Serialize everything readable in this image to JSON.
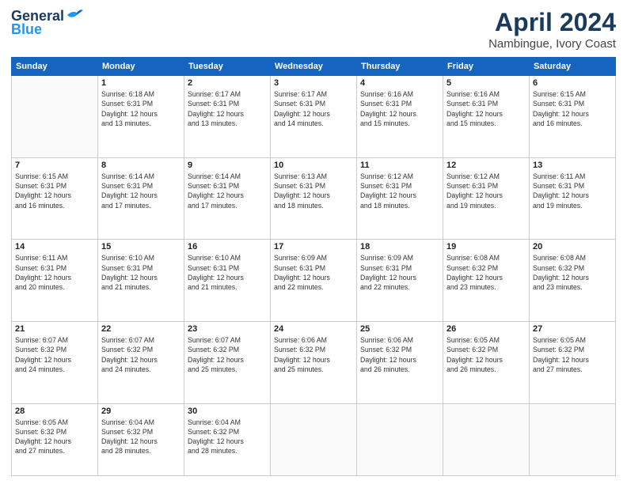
{
  "logo": {
    "line1": "General",
    "line2": "Blue"
  },
  "title": "April 2024",
  "subtitle": "Nambingue, Ivory Coast",
  "days_of_week": [
    "Sunday",
    "Monday",
    "Tuesday",
    "Wednesday",
    "Thursday",
    "Friday",
    "Saturday"
  ],
  "weeks": [
    [
      {
        "num": "",
        "info": ""
      },
      {
        "num": "1",
        "info": "Sunrise: 6:18 AM\nSunset: 6:31 PM\nDaylight: 12 hours\nand 13 minutes."
      },
      {
        "num": "2",
        "info": "Sunrise: 6:17 AM\nSunset: 6:31 PM\nDaylight: 12 hours\nand 13 minutes."
      },
      {
        "num": "3",
        "info": "Sunrise: 6:17 AM\nSunset: 6:31 PM\nDaylight: 12 hours\nand 14 minutes."
      },
      {
        "num": "4",
        "info": "Sunrise: 6:16 AM\nSunset: 6:31 PM\nDaylight: 12 hours\nand 15 minutes."
      },
      {
        "num": "5",
        "info": "Sunrise: 6:16 AM\nSunset: 6:31 PM\nDaylight: 12 hours\nand 15 minutes."
      },
      {
        "num": "6",
        "info": "Sunrise: 6:15 AM\nSunset: 6:31 PM\nDaylight: 12 hours\nand 16 minutes."
      }
    ],
    [
      {
        "num": "7",
        "info": "Sunrise: 6:15 AM\nSunset: 6:31 PM\nDaylight: 12 hours\nand 16 minutes."
      },
      {
        "num": "8",
        "info": "Sunrise: 6:14 AM\nSunset: 6:31 PM\nDaylight: 12 hours\nand 17 minutes."
      },
      {
        "num": "9",
        "info": "Sunrise: 6:14 AM\nSunset: 6:31 PM\nDaylight: 12 hours\nand 17 minutes."
      },
      {
        "num": "10",
        "info": "Sunrise: 6:13 AM\nSunset: 6:31 PM\nDaylight: 12 hours\nand 18 minutes."
      },
      {
        "num": "11",
        "info": "Sunrise: 6:12 AM\nSunset: 6:31 PM\nDaylight: 12 hours\nand 18 minutes."
      },
      {
        "num": "12",
        "info": "Sunrise: 6:12 AM\nSunset: 6:31 PM\nDaylight: 12 hours\nand 19 minutes."
      },
      {
        "num": "13",
        "info": "Sunrise: 6:11 AM\nSunset: 6:31 PM\nDaylight: 12 hours\nand 19 minutes."
      }
    ],
    [
      {
        "num": "14",
        "info": "Sunrise: 6:11 AM\nSunset: 6:31 PM\nDaylight: 12 hours\nand 20 minutes."
      },
      {
        "num": "15",
        "info": "Sunrise: 6:10 AM\nSunset: 6:31 PM\nDaylight: 12 hours\nand 21 minutes."
      },
      {
        "num": "16",
        "info": "Sunrise: 6:10 AM\nSunset: 6:31 PM\nDaylight: 12 hours\nand 21 minutes."
      },
      {
        "num": "17",
        "info": "Sunrise: 6:09 AM\nSunset: 6:31 PM\nDaylight: 12 hours\nand 22 minutes."
      },
      {
        "num": "18",
        "info": "Sunrise: 6:09 AM\nSunset: 6:31 PM\nDaylight: 12 hours\nand 22 minutes."
      },
      {
        "num": "19",
        "info": "Sunrise: 6:08 AM\nSunset: 6:32 PM\nDaylight: 12 hours\nand 23 minutes."
      },
      {
        "num": "20",
        "info": "Sunrise: 6:08 AM\nSunset: 6:32 PM\nDaylight: 12 hours\nand 23 minutes."
      }
    ],
    [
      {
        "num": "21",
        "info": "Sunrise: 6:07 AM\nSunset: 6:32 PM\nDaylight: 12 hours\nand 24 minutes."
      },
      {
        "num": "22",
        "info": "Sunrise: 6:07 AM\nSunset: 6:32 PM\nDaylight: 12 hours\nand 24 minutes."
      },
      {
        "num": "23",
        "info": "Sunrise: 6:07 AM\nSunset: 6:32 PM\nDaylight: 12 hours\nand 25 minutes."
      },
      {
        "num": "24",
        "info": "Sunrise: 6:06 AM\nSunset: 6:32 PM\nDaylight: 12 hours\nand 25 minutes."
      },
      {
        "num": "25",
        "info": "Sunrise: 6:06 AM\nSunset: 6:32 PM\nDaylight: 12 hours\nand 26 minutes."
      },
      {
        "num": "26",
        "info": "Sunrise: 6:05 AM\nSunset: 6:32 PM\nDaylight: 12 hours\nand 26 minutes."
      },
      {
        "num": "27",
        "info": "Sunrise: 6:05 AM\nSunset: 6:32 PM\nDaylight: 12 hours\nand 27 minutes."
      }
    ],
    [
      {
        "num": "28",
        "info": "Sunrise: 6:05 AM\nSunset: 6:32 PM\nDaylight: 12 hours\nand 27 minutes."
      },
      {
        "num": "29",
        "info": "Sunrise: 6:04 AM\nSunset: 6:32 PM\nDaylight: 12 hours\nand 28 minutes."
      },
      {
        "num": "30",
        "info": "Sunrise: 6:04 AM\nSunset: 6:32 PM\nDaylight: 12 hours\nand 28 minutes."
      },
      {
        "num": "",
        "info": ""
      },
      {
        "num": "",
        "info": ""
      },
      {
        "num": "",
        "info": ""
      },
      {
        "num": "",
        "info": ""
      }
    ]
  ]
}
